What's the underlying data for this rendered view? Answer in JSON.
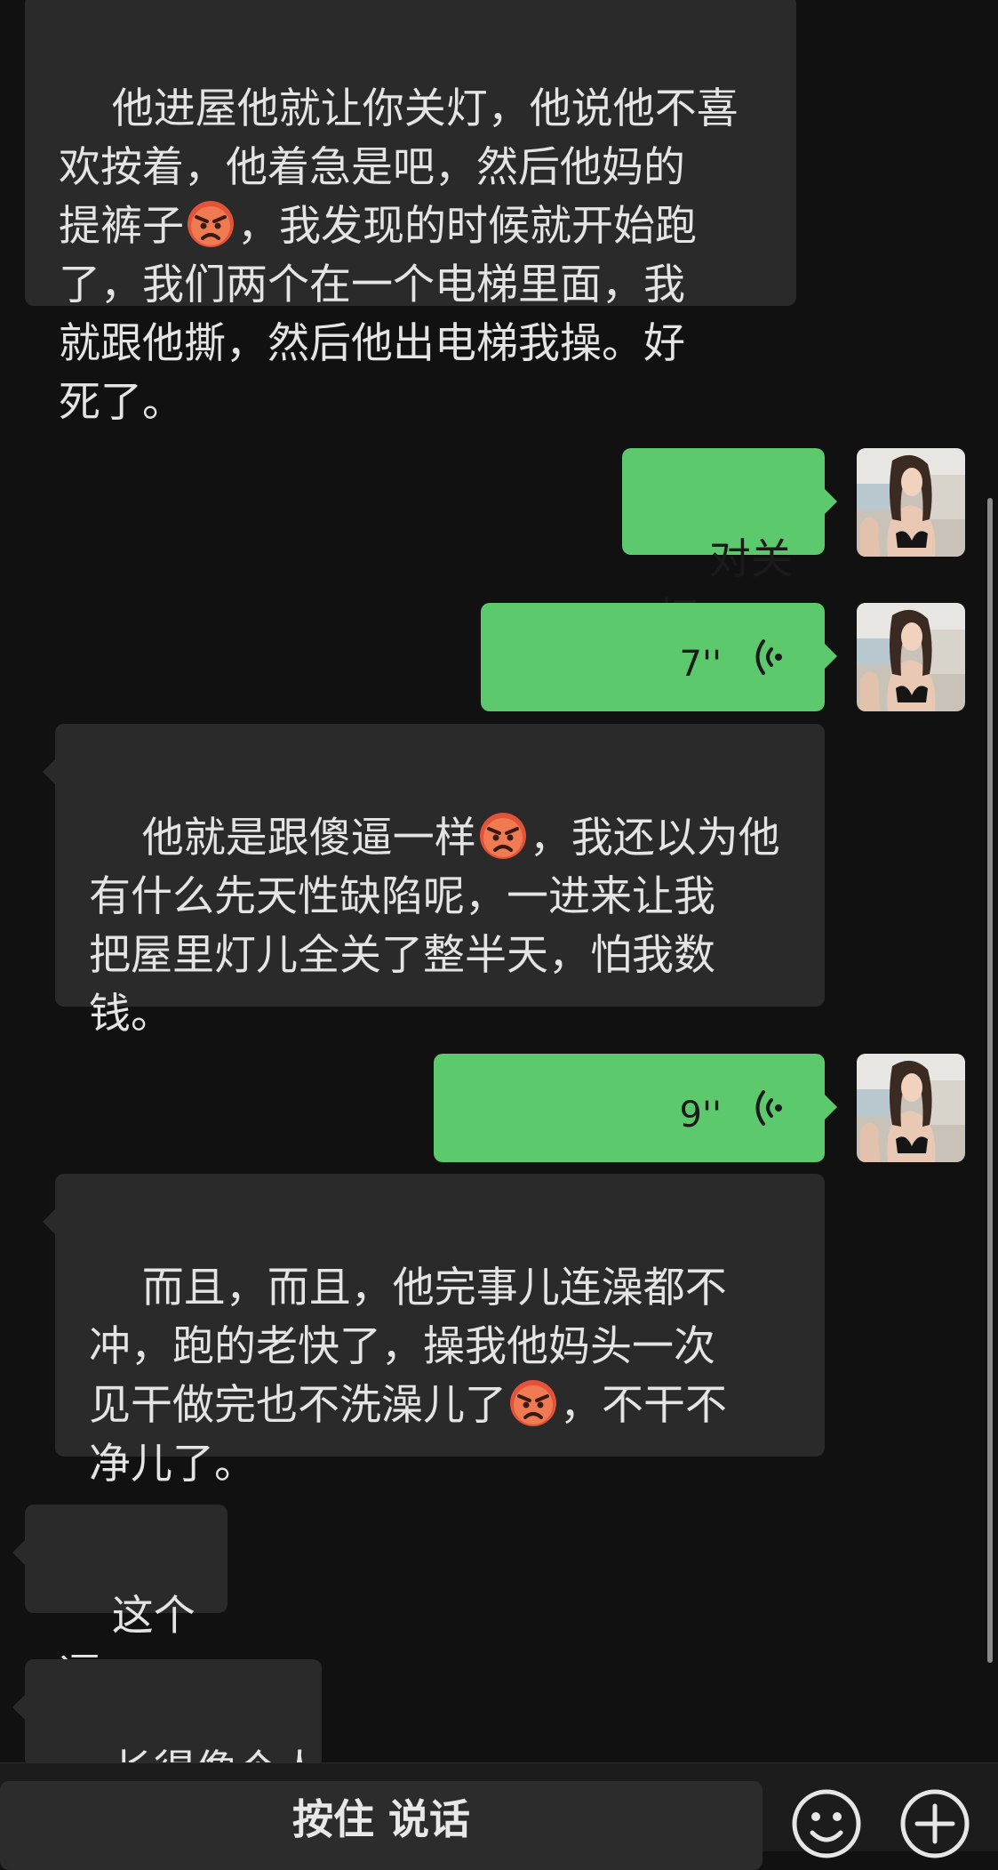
{
  "messages": {
    "m1": {
      "part1": "他进屋他就让你关灯，他说他不喜\n欢按着，他着急是吧，然后他妈的\n提裤子",
      "emoji": "angry-face-emoji",
      "part2": "，我发现的时候就开始跑\n了，我们两个在一个电梯里面，我\n就跟他撕，然后他出电梯我操。好\n死了。"
    },
    "m2": {
      "text": "对关灯"
    },
    "m3": {
      "duration": "7''"
    },
    "m4": {
      "part1": "他就是跟傻逼一样",
      "emoji": "angry-face-emoji",
      "part2": "，我还以为他\n有什么先天性缺陷呢，一进来让我\n把屋里灯儿全关了整半天，怕我数\n钱。"
    },
    "m5": {
      "duration": "9''"
    },
    "m6": {
      "part1": "而且，而且，他完事儿连澡都不\n冲，跑的老快了，操我他妈头一次\n见干做完也不洗澡儿了",
      "emoji": "angry-face-emoji",
      "part2": "，不干不\n净儿了。"
    },
    "m7": {
      "text": "这个逼"
    },
    "m8": {
      "text": "长得像个人"
    }
  },
  "input_bar": {
    "hold_to_talk_label": "按住 说话",
    "emoji_icon": "smiley-icon",
    "plus_icon": "plus-circle-icon"
  },
  "colors": {
    "background": "#111111",
    "incoming_bubble": "#2a2a2a",
    "outgoing_bubble": "#5cc96d"
  }
}
